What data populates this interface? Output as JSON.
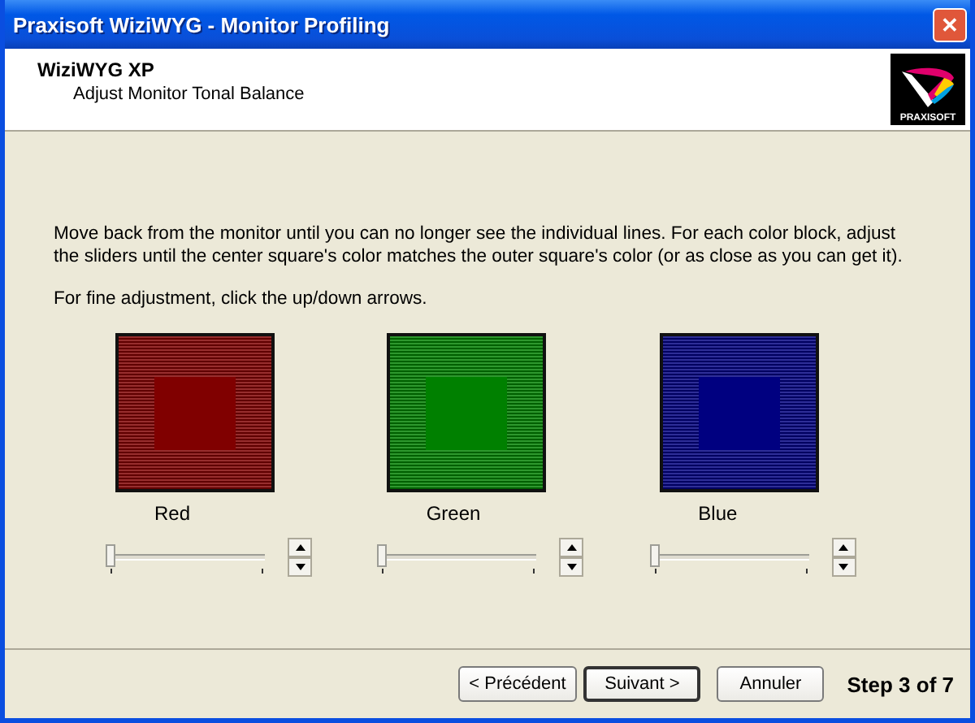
{
  "window": {
    "title": "Praxisoft WiziWYG - Monitor Profiling",
    "close_glyph": "✕"
  },
  "header": {
    "title": "WiziWYG XP",
    "subtitle": "Adjust Monitor Tonal Balance",
    "logo_text": "PRAXISOFT"
  },
  "instructions": [
    "Move back from the monitor until you can no longer see the individual lines. For each color block, adjust the sliders until the center square's color matches the outer square's color (or as close as you can get it).",
    "For fine adjustment, click the up/down arrows."
  ],
  "channels": [
    {
      "name": "Red",
      "color": "#800000",
      "level": 0
    },
    {
      "name": "Green",
      "color": "#008000",
      "level": 0
    },
    {
      "name": "Blue",
      "color": "#000080",
      "level": 0
    }
  ],
  "buttons": [
    {
      "label": "< Précédent",
      "default": false
    },
    {
      "label": "Suivant >",
      "default": true
    },
    {
      "label": "Annuler",
      "default": false
    }
  ],
  "step": "Step 3 of 7"
}
